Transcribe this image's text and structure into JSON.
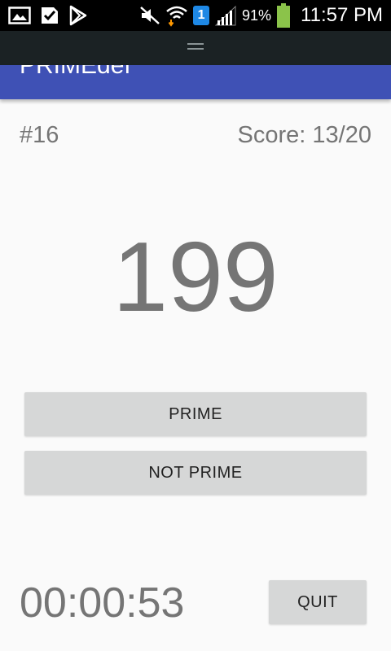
{
  "status_bar": {
    "icons_left": [
      "image-icon",
      "check-notification-icon",
      "play-store-icon"
    ],
    "icons_right": [
      "mute-icon",
      "wifi-download-icon",
      "sim-1-icon",
      "signal-icon",
      "battery-icon"
    ],
    "sim_label": "1",
    "battery_percent": "91%",
    "time": "11:57 PM",
    "colors": {
      "background": "#000000",
      "battery": "#8bc34a",
      "sim": "#1e88e5",
      "download_arrow": "#ff9800"
    }
  },
  "app_bar": {
    "title": "PRIMEdef",
    "color": "#3f51b5"
  },
  "quiz": {
    "question_number": "#16",
    "score": "Score: 13/20",
    "number": "199"
  },
  "buttons": {
    "prime": "PRIME",
    "not_prime": "NOT PRIME",
    "quit": "QUIT"
  },
  "timer": {
    "elapsed": "00:00:53"
  }
}
